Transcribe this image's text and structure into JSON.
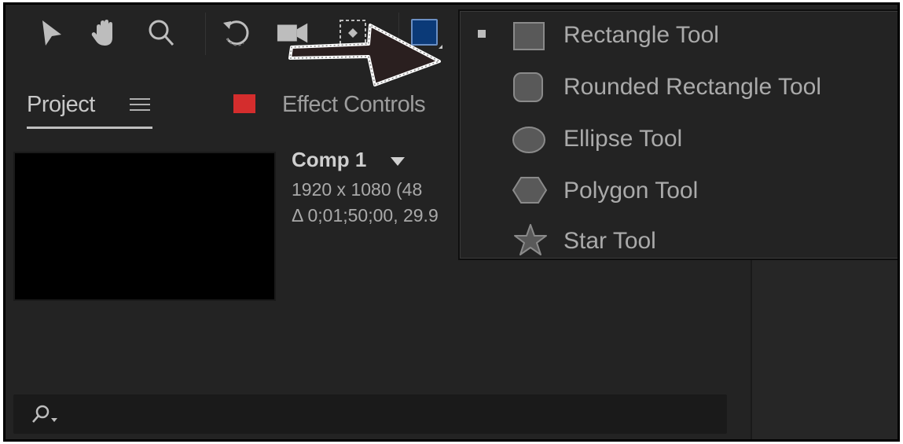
{
  "toolbar": {
    "tools": [
      {
        "name": "selection-tool",
        "icon": "arrow-pointer-icon"
      },
      {
        "name": "hand-tool",
        "icon": "hand-icon"
      },
      {
        "name": "zoom-tool",
        "icon": "magnifier-icon"
      },
      {
        "name": "rotation-tool",
        "icon": "rotate-icon"
      },
      {
        "name": "camera-tool",
        "icon": "camera-icon"
      },
      {
        "name": "pan-behind-tool",
        "icon": "pan-behind-icon"
      },
      {
        "name": "shape-tool",
        "icon": "rectangle-icon",
        "color": "#0b3a78"
      }
    ]
  },
  "panels": {
    "project_tab": "Project",
    "effect_controls_tab": "Effect Controls",
    "effect_swatch_color": "#d42d2d"
  },
  "comp": {
    "name": "Comp 1",
    "dimensions": "1920 x 1080  (48",
    "duration": "Δ 0;01;50;00, 29.9"
  },
  "search": {
    "icon": "search-icon"
  },
  "shape_menu": {
    "items": [
      {
        "label": "Rectangle Tool",
        "icon": "rectangle-icon",
        "selected": true
      },
      {
        "label": "Rounded Rectangle Tool",
        "icon": "rounded-rectangle-icon",
        "selected": false
      },
      {
        "label": "Ellipse Tool",
        "icon": "ellipse-icon",
        "selected": false
      },
      {
        "label": "Polygon Tool",
        "icon": "polygon-icon",
        "selected": false
      },
      {
        "label": "Star Tool",
        "icon": "star-icon",
        "selected": false
      }
    ]
  }
}
